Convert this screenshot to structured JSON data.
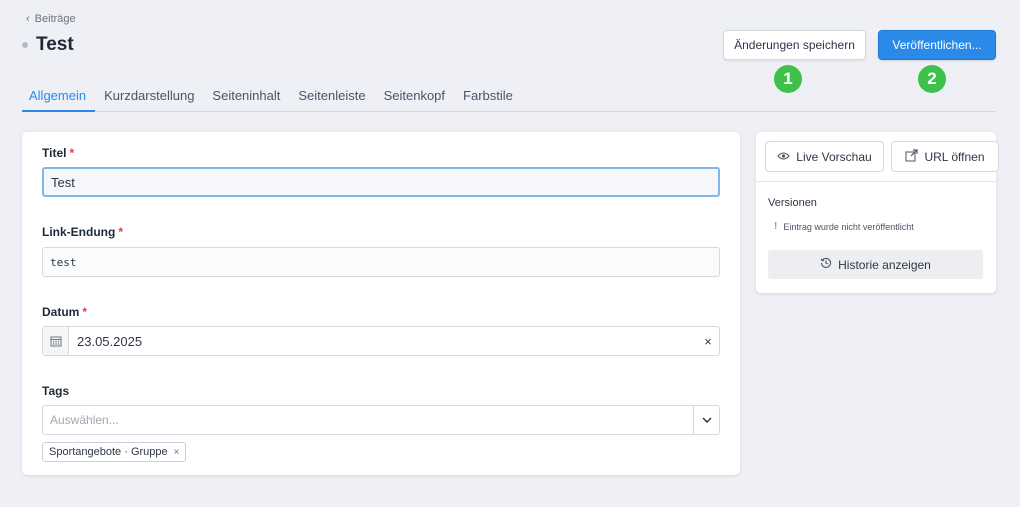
{
  "breadcrumb": {
    "label": "Beiträge"
  },
  "header": {
    "title": "Test",
    "save_label": "Änderungen speichern",
    "publish_label": "Veröffentlichen...",
    "step_badges": [
      "1",
      "2"
    ]
  },
  "tabs": [
    {
      "label": "Allgemein",
      "active": true
    },
    {
      "label": "Kurzdarstellung",
      "active": false
    },
    {
      "label": "Seiteninhalt",
      "active": false
    },
    {
      "label": "Seitenleiste",
      "active": false
    },
    {
      "label": "Seitenkopf",
      "active": false
    },
    {
      "label": "Farbstile",
      "active": false
    }
  ],
  "form": {
    "title": {
      "label": "Titel",
      "required_mark": "*",
      "value": "Test"
    },
    "slug": {
      "label": "Link-Endung",
      "required_mark": "*",
      "value": "test"
    },
    "date": {
      "label": "Datum",
      "required_mark": "*",
      "value": "23.05.2025",
      "clear": "×"
    },
    "tags": {
      "label": "Tags",
      "placeholder": "Auswählen...",
      "selected": [
        "Sportangebote · Gruppe"
      ],
      "remove": "×"
    }
  },
  "sidebar": {
    "preview_label": "Live Vorschau",
    "open_url_label": "URL öffnen",
    "versions_title": "Versionen",
    "version_warning_icon": "!",
    "version_note": "Eintrag wurde nicht veröffentlicht",
    "history_label": "Historie anzeigen"
  },
  "colors": {
    "accent": "#2b8ae8",
    "badge": "#3ec14a",
    "required": "#e53e3e",
    "warning": "#e08a1e",
    "background": "#eef0f5"
  },
  "icons": [
    "chevron-left-icon",
    "status-dot-icon",
    "calendar-icon",
    "chevron-down-icon",
    "eye-icon",
    "external-link-icon",
    "history-icon",
    "warning-icon"
  ]
}
